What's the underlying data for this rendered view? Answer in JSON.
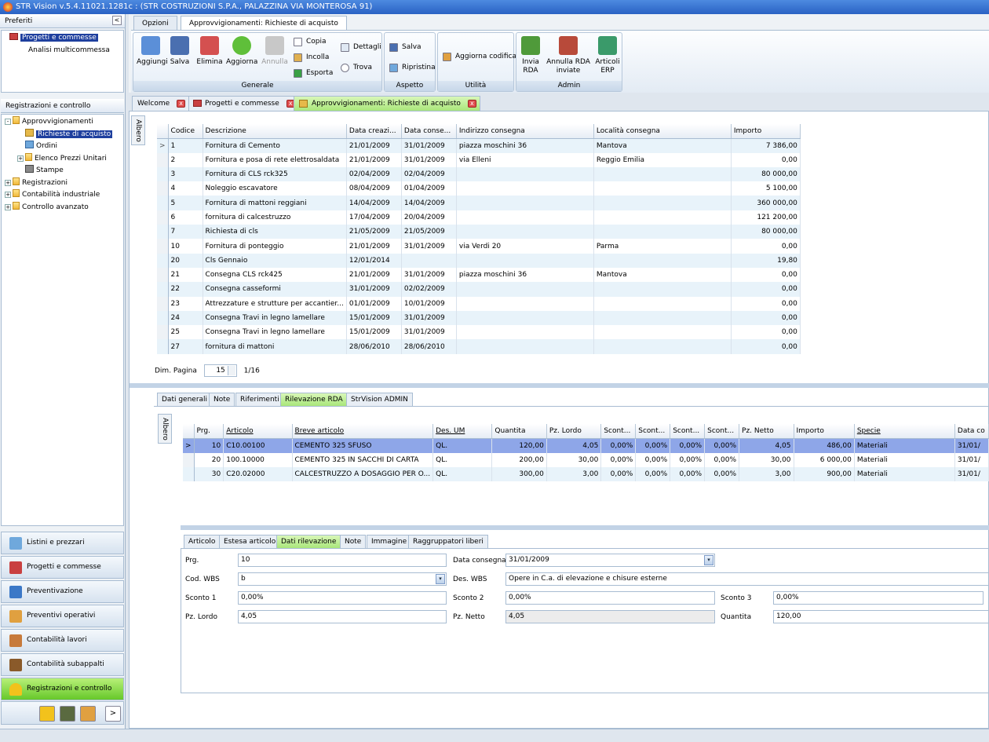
{
  "window": {
    "title": "STR Vision v.5.4.11021.1281c : (STR COSTRUZIONI S.P.A., PALAZZINA VIA MONTEROSA 91)"
  },
  "sidebar": {
    "favorites_header": "Preferiti",
    "favorites": [
      "Progetti e commesse",
      "Analisi multicommessa"
    ],
    "section_header": "Registrazioni e controllo",
    "tree": {
      "root": "Approvvigionamenti",
      "children": [
        "Richieste di acquisto",
        "Ordini",
        "Elenco Prezzi Unitari",
        "Stampe"
      ],
      "others": [
        "Registrazioni",
        "Contabilità industriale",
        "Controllo avanzato"
      ]
    },
    "nav": [
      {
        "label": "Listini e prezzari",
        "color": "#6fa8dc"
      },
      {
        "label": "Progetti e commesse",
        "color": "#c94040"
      },
      {
        "label": "Preventivazione",
        "color": "#3b78c7"
      },
      {
        "label": "Preventivi operativi",
        "color": "#e0a040"
      },
      {
        "label": "Contabilità lavori",
        "color": "#c77a3b"
      },
      {
        "label": "Contabilità subappalti",
        "color": "#8a5a2a"
      },
      {
        "label": "Registrazioni e controllo",
        "color": "#f2c21c"
      }
    ],
    "collapse_symbol": "<",
    "more_symbol": ">"
  },
  "ribbon": {
    "tabs": [
      "Opzioni",
      "Approvvigionamenti: Richieste di acquisto"
    ],
    "groups": {
      "generale": {
        "label": "Generale",
        "buttons": [
          "Aggiungi",
          "Salva",
          "Elimina",
          "Aggiorna",
          "Annulla"
        ],
        "small": [
          "Copia",
          "Incolla",
          "Esporta",
          "Dettagli",
          "Trova"
        ]
      },
      "aspetto": {
        "label": "Aspetto",
        "small": [
          "Salva",
          "Ripristina"
        ]
      },
      "utilita": {
        "label": "Utilità",
        "small": [
          "Aggiorna codifica"
        ]
      },
      "admin": {
        "label": "Admin",
        "buttons": [
          "Invia\nRDA",
          "Annulla RDA\ninviate",
          "Articoli\nERP"
        ]
      }
    }
  },
  "doc_tabs": [
    "Welcome",
    "Progetti e commesse",
    "Approvvigionamenti: Richieste di acquisto"
  ],
  "side_tab": "Albero",
  "requests_grid": {
    "columns": [
      "Codice",
      "Descrizione",
      "Data creazi...",
      "Data conse...",
      "Indirizzo consegna",
      "Località consegna",
      "Importo"
    ],
    "rows": [
      [
        "1",
        "Fornitura di Cemento",
        "21/01/2009",
        "31/01/2009",
        "piazza moschini 36",
        "Mantova",
        "7 386,00"
      ],
      [
        "2",
        "Fornitura e posa di rete elettrosaldata",
        "21/01/2009",
        "31/01/2009",
        "via Elleni",
        "Reggio Emilia",
        "0,00"
      ],
      [
        "3",
        "Fornitura di CLS rck325",
        "02/04/2009",
        "02/04/2009",
        "",
        "",
        "80 000,00"
      ],
      [
        "4",
        "Noleggio escavatore",
        "08/04/2009",
        "01/04/2009",
        "",
        "",
        "5 100,00"
      ],
      [
        "5",
        "Fornitura di mattoni reggiani",
        "14/04/2009",
        "14/04/2009",
        "",
        "",
        "360 000,00"
      ],
      [
        "6",
        "fornitura di calcestruzzo",
        "17/04/2009",
        "20/04/2009",
        "",
        "",
        "121 200,00"
      ],
      [
        "7",
        "Richiesta di cls",
        "21/05/2009",
        "21/05/2009",
        "",
        "",
        "80 000,00"
      ],
      [
        "10",
        "Fornitura di ponteggio",
        "21/01/2009",
        "31/01/2009",
        "via Verdi 20",
        "Parma",
        "0,00"
      ],
      [
        "20",
        "Cls Gennaio",
        "12/01/2014",
        "",
        "",
        "",
        "19,80"
      ],
      [
        "21",
        "Consegna CLS rck425",
        "21/01/2009",
        "31/01/2009",
        "piazza moschini 36",
        "Mantova",
        "0,00"
      ],
      [
        "22",
        "Consegna casseformi",
        "31/01/2009",
        "02/02/2009",
        "",
        "",
        "0,00"
      ],
      [
        "23",
        "Attrezzature e strutture per accantier...",
        "01/01/2009",
        "10/01/2009",
        "",
        "",
        "0,00"
      ],
      [
        "24",
        "Consegna Travi in legno lamellare",
        "15/01/2009",
        "31/01/2009",
        "",
        "",
        "0,00"
      ],
      [
        "25",
        "Consegna Travi in legno lamellare",
        "15/01/2009",
        "31/01/2009",
        "",
        "",
        "0,00"
      ],
      [
        "27",
        "fornitura di mattoni",
        "28/06/2010",
        "28/06/2010",
        "",
        "",
        "0,00"
      ]
    ],
    "current_marker": ">"
  },
  "pager": {
    "label": "Dim. Pagina",
    "size": "15",
    "page": "1/16"
  },
  "detail_tabs": [
    "Dati generali",
    "Note",
    "Riferimenti",
    "Rilevazione RDA",
    "StrVision ADMIN"
  ],
  "items_grid": {
    "columns": [
      "Prg.",
      "Articolo",
      "Breve articolo",
      "Des. UM",
      "Quantita",
      "Pz. Lordo",
      "Scont...",
      "Scont...",
      "Scont...",
      "Scont...",
      "Pz. Netto",
      "Importo",
      "Specie",
      "Data co"
    ],
    "rows": [
      [
        "10",
        "C10.00100",
        "CEMENTO 325 SFUSO",
        "QL.",
        "120,00",
        "4,05",
        "0,00%",
        "0,00%",
        "0,00%",
        "0,00%",
        "4,05",
        "486,00",
        "Materiali",
        "31/01/"
      ],
      [
        "20",
        "100.10000",
        "CEMENTO 325 IN SACCHI DI CARTA",
        "QL.",
        "200,00",
        "30,00",
        "0,00%",
        "0,00%",
        "0,00%",
        "0,00%",
        "30,00",
        "6 000,00",
        "Materiali",
        "31/01/"
      ],
      [
        "30",
        "C20.02000",
        "CALCESTRUZZO A DOSAGGIO PER O...",
        "QL.",
        "300,00",
        "3,00",
        "0,00%",
        "0,00%",
        "0,00%",
        "0,00%",
        "3,00",
        "900,00",
        "Materiali",
        "31/01/"
      ]
    ]
  },
  "article_tabs": [
    "Articolo",
    "Estesa articolo",
    "Dati rilevazione",
    "Note",
    "Immagine",
    "Raggruppatori liberi"
  ],
  "form": {
    "prg": {
      "label": "Prg.",
      "value": "10"
    },
    "data_consegna": {
      "label": "Data consegna",
      "value": "31/01/2009"
    },
    "cod_wbs": {
      "label": "Cod. WBS",
      "value": "b"
    },
    "des_wbs": {
      "label": "Des. WBS",
      "value": "Opere in C.a. di elevazione e chisure esterne"
    },
    "sconto1": {
      "label": "Sconto 1",
      "value": "0,00%"
    },
    "sconto2": {
      "label": "Sconto 2",
      "value": "0,00%"
    },
    "sconto3": {
      "label": "Sconto 3",
      "value": "0,00%"
    },
    "pz_lordo": {
      "label": "Pz. Lordo",
      "value": "4,05"
    },
    "pz_netto": {
      "label": "Pz. Netto",
      "value": "4,05"
    },
    "quantita": {
      "label": "Quantita",
      "value": "120,00"
    }
  },
  "symbols": {
    "close": "x",
    "dropdown": "▾"
  }
}
